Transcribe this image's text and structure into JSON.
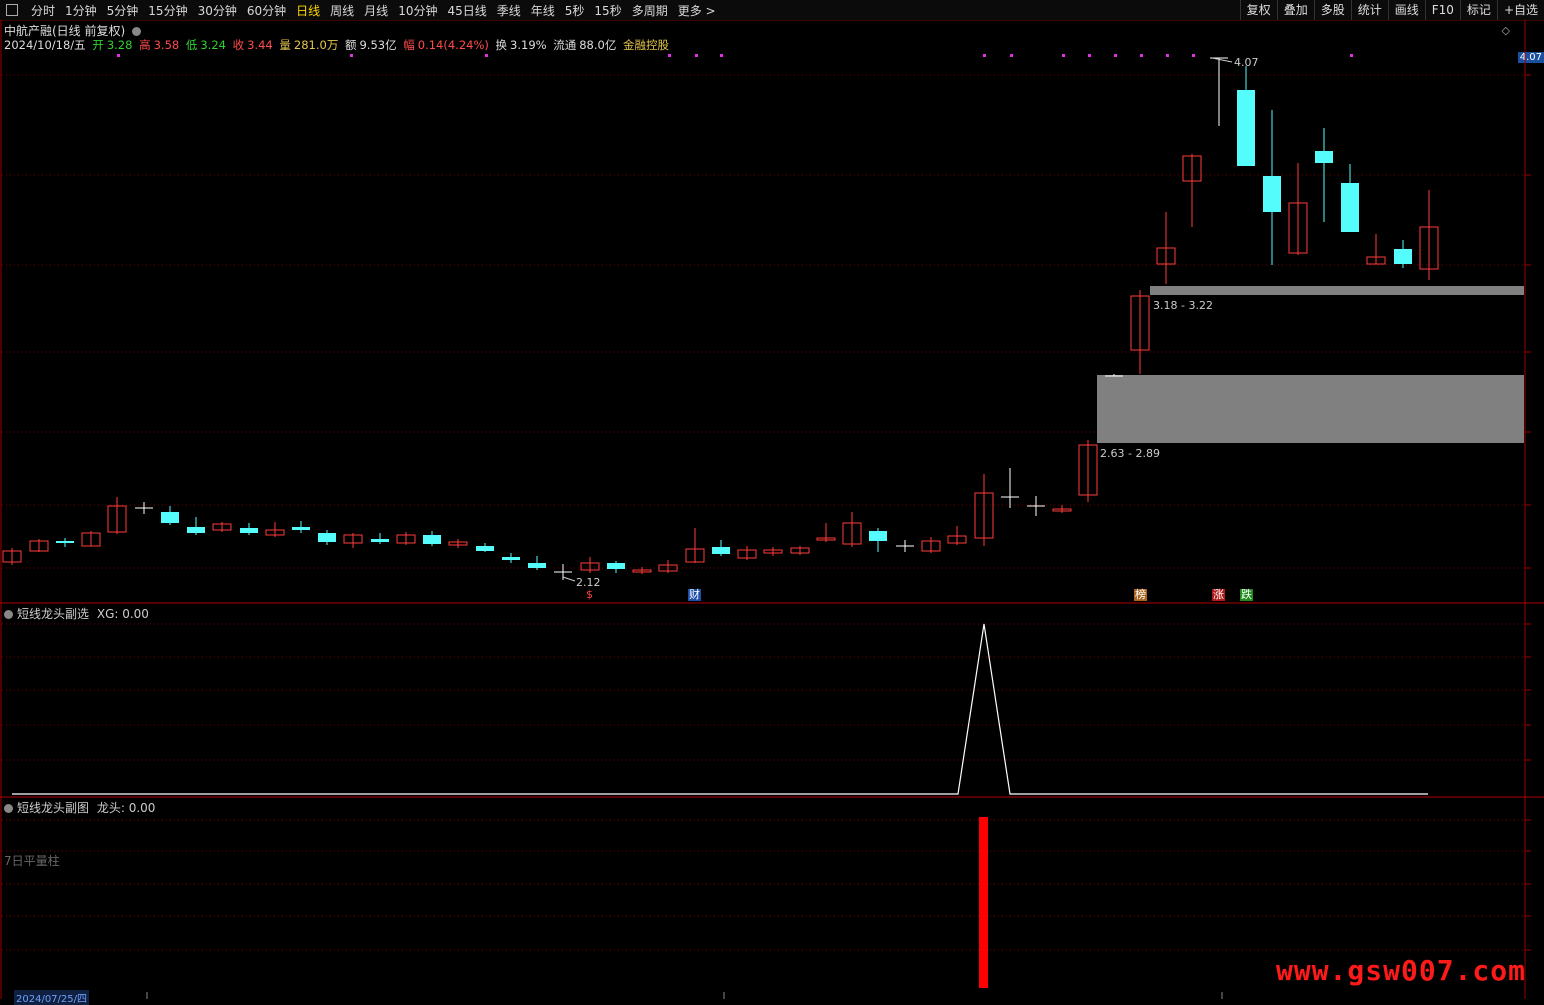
{
  "toolbar": {
    "tabs": [
      "分时",
      "1分钟",
      "5分钟",
      "15分钟",
      "30分钟",
      "60分钟",
      "日线",
      "周线",
      "月线",
      "10分钟",
      "45日线",
      "季线",
      "年线",
      "5秒",
      "15秒",
      "多周期",
      "更多 >"
    ],
    "active_tab": "日线",
    "tools": [
      "复权",
      "叠加",
      "多股",
      "统计",
      "画线",
      "F10",
      "标记",
      "+自选"
    ]
  },
  "stock": {
    "title": "中航产融(日线 前复权)",
    "date": "2024/10/18/五",
    "open_label": "开",
    "open": "3.28",
    "high_label": "高",
    "high": "3.58",
    "low_label": "低",
    "low": "3.24",
    "close_label": "收",
    "close": "3.44",
    "volume_label": "量",
    "volume": "281.0万",
    "amount_label": "额",
    "amount": "9.53亿",
    "change_label": "幅",
    "change": "0.14(4.24%)",
    "turnover_label": "换",
    "turnover": "3.19%",
    "float_label": "流通",
    "float_cap": "88.0亿",
    "concept": "金融控股"
  },
  "price_chart": {
    "last_price_box": "4.07",
    "high_marker": "4.07",
    "low_marker": "2.12",
    "zone1_label": "3.18 - 3.22",
    "zone2_label": "2.63 - 2.89",
    "badges": [
      "$",
      "财",
      "榜",
      "涨",
      "跌"
    ],
    "colors": {
      "up": "#ff3b3b",
      "down": "#54fcfc",
      "zone": "#808080",
      "grid": "#7a0000"
    }
  },
  "pane1": {
    "title": "短线龙头副选",
    "indicator": "XG: 0.00"
  },
  "pane2": {
    "title": "短线龙头副图",
    "indicator": "龙头: 0.00",
    "overlay_label": "7日平量柱"
  },
  "footer": {
    "date": "2024/07/25/四"
  },
  "watermark": "www.gsw007.com"
}
